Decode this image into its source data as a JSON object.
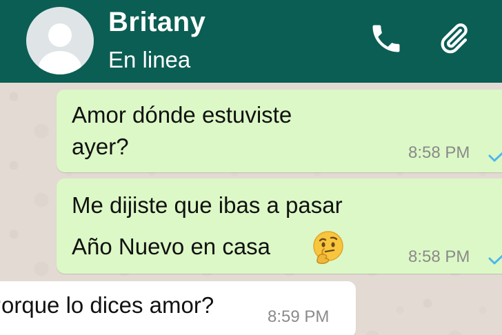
{
  "header": {
    "contact_name": "Britany",
    "status": "En linea",
    "icons": [
      "avatar",
      "phone-icon",
      "paperclip-icon"
    ],
    "color": "#0b5e54"
  },
  "messages": [
    {
      "direction": "outgoing",
      "lines": [
        "Amor dónde estuviste",
        "ayer?"
      ],
      "time": "8:58 PM",
      "status_icon": "delivered-check-icon"
    },
    {
      "direction": "outgoing",
      "lines": [
        "Me dijiste que ibas a pasar",
        "Año Nuevo en casa"
      ],
      "emoji": "thinking-face-icon",
      "time": "8:58 PM",
      "status_icon": "delivered-check-icon"
    },
    {
      "direction": "incoming",
      "lines": [
        "Porque lo dices amor?"
      ],
      "time": "8:59 PM"
    }
  ],
  "colors": {
    "outgoing_bubble": "#dcf8c6",
    "incoming_bubble": "#ffffff",
    "check": "#4fb6ec"
  }
}
